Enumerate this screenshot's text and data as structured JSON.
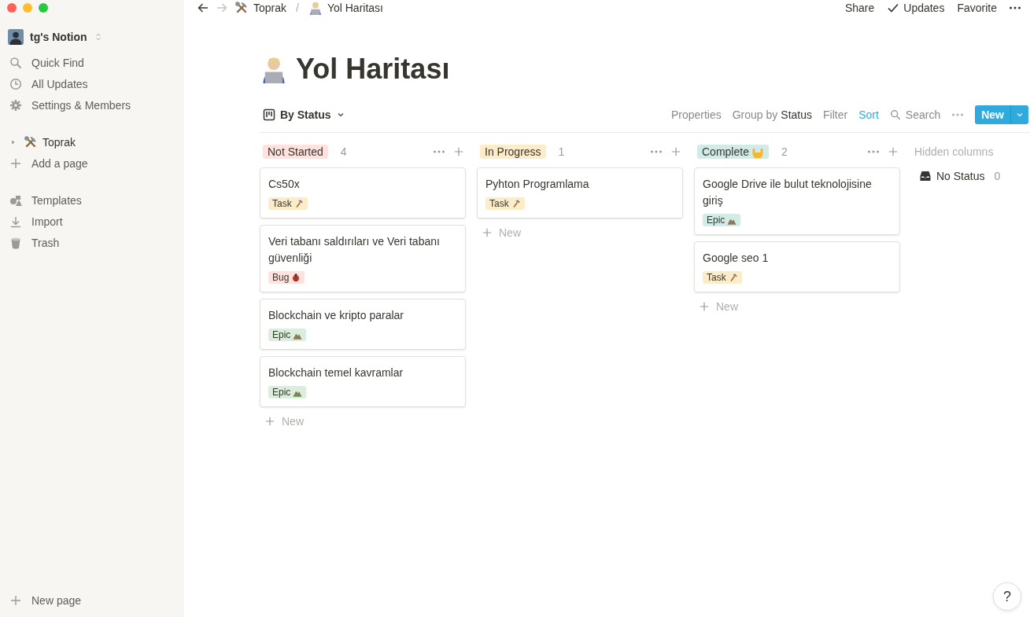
{
  "sidebar": {
    "workspace": "tg's Notion",
    "nav": [
      {
        "label": "Quick Find",
        "kind": "search"
      },
      {
        "label": "All Updates",
        "kind": "clock"
      },
      {
        "label": "Settings & Members",
        "kind": "gear"
      }
    ],
    "pages": [
      {
        "label": "Toprak",
        "kind": "tools",
        "expanded": false
      }
    ],
    "add_page": "Add a page",
    "tools": [
      {
        "label": "Templates",
        "kind": "templates"
      },
      {
        "label": "Import",
        "kind": "import"
      },
      {
        "label": "Trash",
        "kind": "trash"
      }
    ],
    "new_page": "New page"
  },
  "topbar": {
    "breadcrumbs": [
      {
        "label": "Toprak",
        "kind": "tools"
      },
      {
        "label": "Yol Haritası",
        "kind": "person-laptop"
      }
    ],
    "separator": "/",
    "share": "Share",
    "updates": "Updates",
    "favorite": "Favorite"
  },
  "page": {
    "title": "Yol Haritası",
    "kind": "person-laptop"
  },
  "view": {
    "name": "By Status",
    "properties": "Properties",
    "group_by": "Group by",
    "group_value": "Status",
    "filter": "Filter",
    "sort": "Sort",
    "sort_active": true,
    "search": "Search",
    "new": "New"
  },
  "groups": [
    {
      "label": "Not Started",
      "color": "#ffe2dd",
      "kind": "plain",
      "count": "4",
      "add": "New",
      "cards": [
        {
          "title": "Cs50x",
          "tag": {
            "label": "Task",
            "kind": "hammer",
            "color": "#fdecc8"
          }
        },
        {
          "title": "Veri tabanı saldırıları ve Veri tabanı güvenliği",
          "tag": {
            "label": "Bug",
            "kind": "ladybug",
            "color": "#ffe2dd"
          }
        },
        {
          "title": "Blockchain ve kripto paralar",
          "tag": {
            "label": "Epic",
            "kind": "mountain",
            "color": "#dbeddb"
          }
        },
        {
          "title": "Blockchain temel kavramlar",
          "tag": {
            "label": "Epic",
            "kind": "mountain",
            "color": "#dbeddb"
          }
        }
      ]
    },
    {
      "label": "In Progress",
      "color": "#fdecc8",
      "kind": "plain",
      "count": "1",
      "add": "New",
      "cards": [
        {
          "title": "Pyhton Programlama",
          "tag": {
            "label": "Task",
            "kind": "hammer",
            "color": "#fdecc8"
          }
        }
      ]
    },
    {
      "label": "Complete",
      "color": "#d3ebe6",
      "kind": "raised-hands",
      "count": "2",
      "add": "New",
      "cards": [
        {
          "title": "Google Drive ile bulut teknolojisine giriş",
          "tag": {
            "label": "Epic",
            "kind": "mountain",
            "color": "#d3ebe6"
          }
        },
        {
          "title": "Google seo 1",
          "tag": {
            "label": "Task",
            "kind": "hammer",
            "color": "#fdecc8"
          }
        }
      ]
    }
  ],
  "hidden": {
    "heading": "Hidden columns",
    "items": [
      {
        "label": "No Status",
        "count": "0"
      }
    ]
  },
  "help": "?"
}
